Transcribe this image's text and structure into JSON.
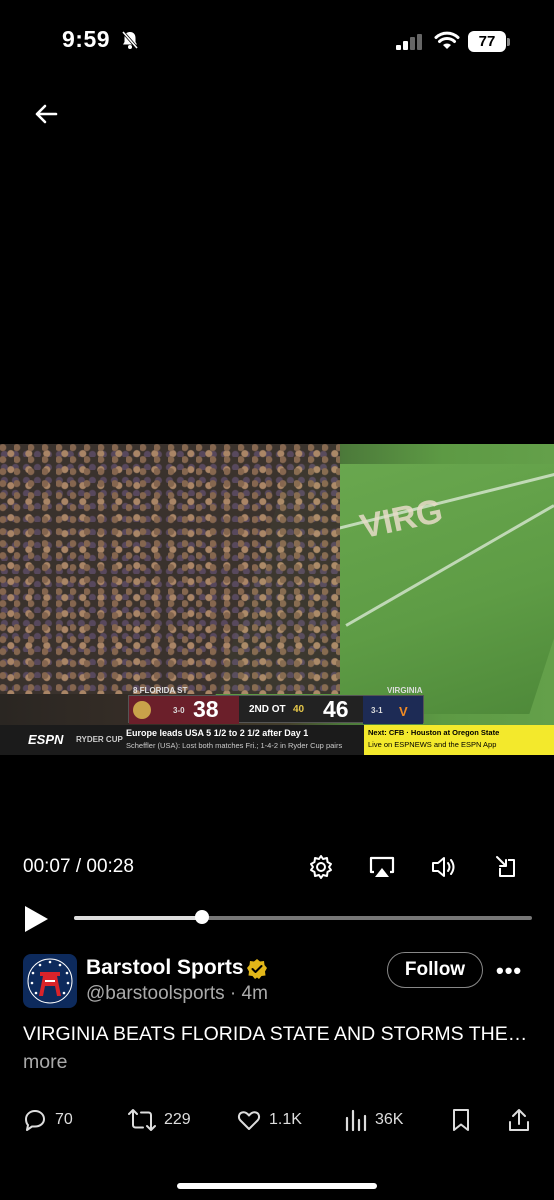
{
  "status_bar": {
    "time": "9:59",
    "battery": "77",
    "icons": [
      "bell-muted-icon",
      "signal-icon",
      "wifi-icon",
      "battery-icon"
    ]
  },
  "nav": {
    "back_icon": "arrow-left-icon"
  },
  "video": {
    "scoreboard": {
      "left_team": "8 FLORIDA ST",
      "left_record": "3-0",
      "left_score": "38",
      "period": "2ND OT",
      "down": "40",
      "right_team": "VIRGINIA",
      "right_record": "3-1",
      "right_score": "46"
    },
    "ticker": {
      "network": "ESPN",
      "label": "RYDER CUP",
      "headline": "Europe leads USA 5 1/2 to 2 1/2 after Day 1",
      "subline": "Scheffler (USA): Lost both matches Fri.; 1-4-2 in Ryder Cup pairs",
      "next_title": "Next: CFB · Houston at Oregon State",
      "next_sub": "Live on ESPNEWS and the ESPN App"
    },
    "endzone_text": "VIRG"
  },
  "player": {
    "time": "00:07 / 00:28",
    "progress": 0.28
  },
  "post": {
    "author": "Barstool Sports",
    "handle": "@barstoolsports · 4m",
    "follow_label": "Follow",
    "more_label": "•••",
    "text": "VIRGINIA BEATS FLORIDA STATE AND STORMS THE…",
    "more_link": "more"
  },
  "actions": {
    "replies": "70",
    "reposts": "229",
    "likes": "1.1K",
    "views": "36K"
  },
  "colors": {
    "accent": "#1d9bf0",
    "verified": "#e2b719"
  }
}
